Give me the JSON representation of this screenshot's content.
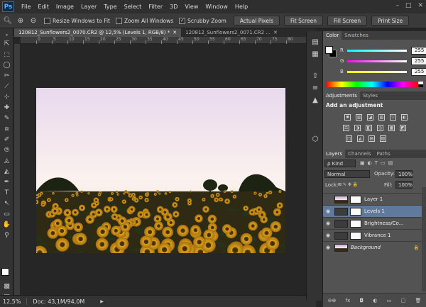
{
  "app": {
    "logo": "Ps"
  },
  "menu": [
    "File",
    "Edit",
    "Image",
    "Layer",
    "Type",
    "Select",
    "Filter",
    "3D",
    "View",
    "Window",
    "Help"
  ],
  "window_controls": [
    "–",
    "□",
    "✕"
  ],
  "options": {
    "zoom_in": "⊕",
    "zoom_out": "⊖",
    "resize_windows": "Resize Windows to Fit",
    "zoom_all_windows": "Zoom All Windows",
    "scrubby_zoom": "Scrubby Zoom",
    "scrubby_checked": "✓",
    "actual_pixels": "Actual Pixels",
    "fit_screen": "Fit Screen",
    "fill_screen": "Fill Screen",
    "print_size": "Print Size"
  },
  "tabs": [
    {
      "label": "120812_Sunflowers2_0070.CR2 @ 12,5% (Levels 1, RGB/8) *",
      "close": "✕"
    },
    {
      "label": "120812_Sunflowers2_0071.CR2 ...",
      "close": "✕"
    }
  ],
  "ruler": [
    "0",
    "5",
    "10",
    "15",
    "20",
    "25",
    "30",
    "35",
    "40",
    "45",
    "50",
    "55",
    "60",
    "65",
    "70",
    "75",
    "80"
  ],
  "status": {
    "zoom": "12,5%",
    "doc": "Doc: 43,1M/94,0M",
    "arrow": "▶"
  },
  "color_panel": {
    "tabs": [
      "Color",
      "Swatches"
    ],
    "rows": [
      {
        "label": "R",
        "value": "255",
        "track": "linear-gradient(to right,#00ffff,#ffffff)"
      },
      {
        "label": "G",
        "value": "255",
        "track": "linear-gradient(to right,#ff00ff,#ffffff)"
      },
      {
        "label": "B",
        "value": "255",
        "track": "linear-gradient(to right,#ffff00,#ffffff)"
      }
    ]
  },
  "adjustments": {
    "tabs": [
      "Adjustments",
      "Styles"
    ],
    "heading": "Add an adjustment",
    "icons": [
      "✺",
      "▥",
      "◪",
      "▨",
      "▽",
      "◐",
      "⚖",
      "◑",
      "◧",
      "◎",
      "▦",
      "◩",
      "◫",
      "◭",
      "▤",
      "▧"
    ]
  },
  "layers_panel": {
    "tabs": [
      "Layers",
      "Channels",
      "Paths"
    ],
    "kind": "ρ Kind",
    "blend_mode": "Normal",
    "opacity_label": "Opacity:",
    "opacity": "100%",
    "lock_label": "Lock:",
    "lock_icons": "⊠ ✎ ✥ 🔒",
    "fill_label": "Fill:",
    "fill": "100%",
    "layers": [
      {
        "name": "Layer 1",
        "eye": "",
        "thumb": "linear-gradient(to bottom,#c9b3d8 0%,#f4e7ea 55%,#2b2210 60%,#3a2f14 100%)",
        "mask": true,
        "selected": false,
        "italic": false
      },
      {
        "name": "Levels 1",
        "eye": "◉",
        "thumb": "#3c3c3c",
        "mask": true,
        "selected": true,
        "italic": false
      },
      {
        "name": "Brightness/Co...",
        "eye": "◉",
        "thumb": "#3c3c3c",
        "mask": true,
        "selected": false,
        "italic": false
      },
      {
        "name": "Vibrance 1",
        "eye": "◉",
        "thumb": "#3c3c3c",
        "mask": true,
        "selected": false,
        "italic": false
      },
      {
        "name": "Background",
        "eye": "◉",
        "thumb": "linear-gradient(to bottom,#c9b3d8 0%,#f4e7ea 55%,#2b2210 60%,#3a2f14 100%)",
        "mask": false,
        "selected": false,
        "italic": true,
        "lock": "🔒"
      }
    ],
    "footer": [
      "⊖⊕",
      "fx",
      "◘",
      "◐",
      "▭",
      "▢",
      "🗑"
    ]
  },
  "tools": [
    "⇱",
    "⬚",
    "◯",
    "✂",
    "⟋",
    "⊹",
    "✚",
    "✎",
    "⧈",
    "✐",
    "⦾",
    "◬",
    "◭",
    "✒",
    "T",
    "↖",
    "▭",
    "✋",
    "⚲",
    "⬛",
    "▩",
    "▣"
  ],
  "strip_icons": [
    "▤",
    "▦",
    "⇧",
    "≡",
    "▲",
    "⬡"
  ],
  "colors": {
    "accent": "#5f7a9c",
    "panel": "#535353",
    "background": "#262626"
  }
}
